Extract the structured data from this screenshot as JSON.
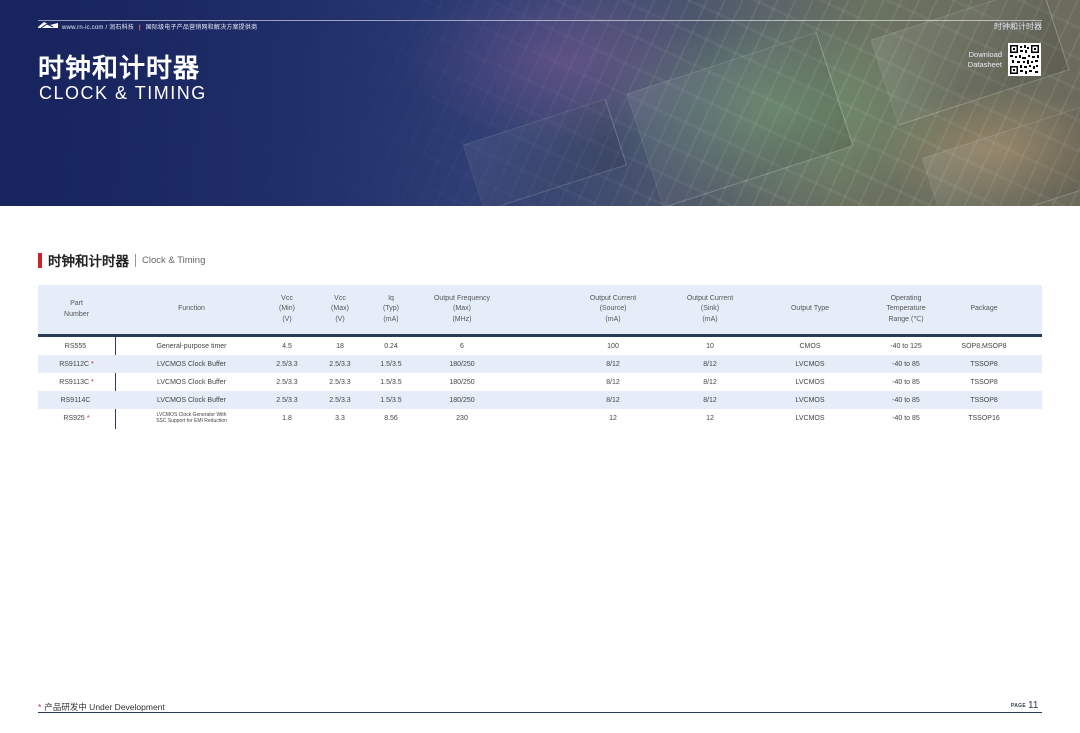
{
  "header": {
    "site": "www.rn-ic.com",
    "brand": "润石科技",
    "tagline": "国际级电子产品营销网和解决方案提供商",
    "section_top": "时钟和计时器",
    "title_cn": "时钟和计时器",
    "title_en": "CLOCK & TIMING",
    "download_line1": "Download",
    "download_line2": "Datasheet"
  },
  "section": {
    "title_cn": "时钟和计时器",
    "title_en": "Clock & Timing"
  },
  "table": {
    "columns": [
      "Part\nNumber",
      "Function",
      "Vcc\n(Min)\n(V)",
      "Vcc\n(Max)\n(V)",
      "Iq\n(Typ)\n(mA)",
      "Output Frequency\n(Max)\n(MHz)",
      "Output Current\n(Source)\n(mA)",
      "Output Current\n(Sink)\n(mA)",
      "Output Type",
      "Operating\nTemperature\nRange (℃)",
      "Package"
    ],
    "rows": [
      {
        "part": "RS555",
        "star": "",
        "function": "General-purpose timer",
        "vcc_min": "4.5",
        "vcc_max": "18",
        "iq": "0.24",
        "freq": "6",
        "source": "100",
        "sink": "10",
        "out_type": "CMOS",
        "temp": "-40 to 125",
        "package": "SOP8,MSOP8"
      },
      {
        "part": "RS9112C",
        "star": "*",
        "function": "LVCMOS  Clock Buffer",
        "vcc_min": "2.5/3.3",
        "vcc_max": "2.5/3.3",
        "iq": "1.5/3.5",
        "freq": "180/250",
        "source": "8/12",
        "sink": "8/12",
        "out_type": "LVCMOS",
        "temp": "-40 to 85",
        "package": "TSSOP8"
      },
      {
        "part": "RS9113C",
        "star": "*",
        "function": "LVCMOS  Clock Buffer",
        "vcc_min": "2.5/3.3",
        "vcc_max": "2.5/3.3",
        "iq": "1.5/3.5",
        "freq": "180/250",
        "source": "8/12",
        "sink": "8/12",
        "out_type": "LVCMOS",
        "temp": "-40 to 85",
        "package": "TSSOP8"
      },
      {
        "part": "RS9114C",
        "star": "",
        "function": "LVCMOS  Clock Buffer",
        "vcc_min": "2.5/3.3",
        "vcc_max": "2.5/3.3",
        "iq": "1.5/3.5",
        "freq": "180/250",
        "source": "8/12",
        "sink": "8/12",
        "out_type": "LVCMOS",
        "temp": "-40 to 85",
        "package": "TSSOP8"
      },
      {
        "part": "RS925",
        "star": "*",
        "function": "LVCMOS Clock Generator With\nSSC Support for EMI Reduction",
        "vcc_min": "1.8",
        "vcc_max": "3.3",
        "iq": "8.56",
        "freq": "230",
        "source": "12",
        "sink": "12",
        "out_type": "LVCMOS",
        "temp": "-40 to 85",
        "package": "TSSOP16"
      }
    ]
  },
  "footer": {
    "star": "*",
    "note": "产品研发中 Under Development",
    "page_label": "PAGE",
    "page_number": "11"
  },
  "colors": {
    "accent_red": "#d0202e",
    "navy": "#2b3a55",
    "table_band": "#e5eef8"
  }
}
